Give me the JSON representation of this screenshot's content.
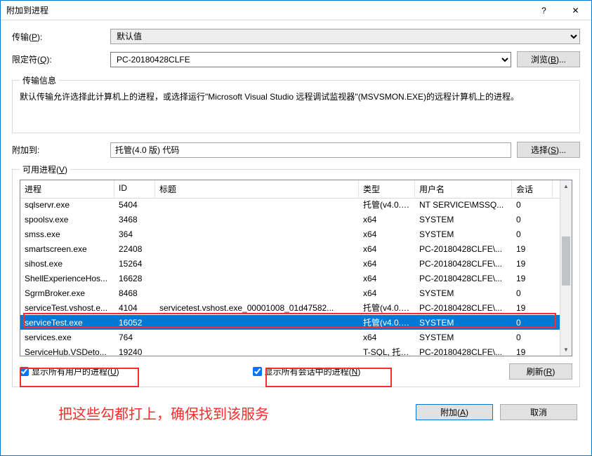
{
  "titlebar": {
    "title": "附加到进程",
    "help": "?",
    "close": "✕"
  },
  "labels": {
    "transport": "传输(<u>P</u>):",
    "qualifier": "限定符(<u>Q</u>):",
    "browse": "浏览(<u>B</u>)...",
    "transport_info_title": "传输信息",
    "transport_info_text": "默认传输允许选择此计算机上的进程，或选择运行\"Microsoft Visual Studio 远程调试监视器\"(MSVSMON.EXE)的远程计算机上的进程。",
    "attach_to": "附加到:",
    "select": "选择(<u>S</u>)...",
    "available_procs": "可用进程(<u>V</u>)",
    "show_all_users": "显示所有用户的进程(<u>U</u>)",
    "show_all_sessions": "显示所有会话中的进程(<u>N</u>)",
    "refresh": "刷新(<u>R</u>)",
    "attach": "附加(<u>A</u>)",
    "cancel": "取消"
  },
  "transport_value": "默认值",
  "qualifier_value": "PC-20180428CLFE",
  "attach_to_value": "托管(4.0 版) 代码",
  "columns": {
    "process": "进程",
    "id": "ID",
    "title": "标题",
    "type": "类型",
    "user": "用户名",
    "session": "会话"
  },
  "rows": [
    {
      "p": "sqlservr.exe",
      "id": "5404",
      "t": "",
      "ty": "托管(v4.0.30...",
      "u": "NT SERVICE\\MSSQ...",
      "s": "0",
      "sel": false
    },
    {
      "p": "spoolsv.exe",
      "id": "3468",
      "t": "",
      "ty": "x64",
      "u": "SYSTEM",
      "s": "0",
      "sel": false
    },
    {
      "p": "smss.exe",
      "id": "364",
      "t": "",
      "ty": "x64",
      "u": "SYSTEM",
      "s": "0",
      "sel": false
    },
    {
      "p": "smartscreen.exe",
      "id": "22408",
      "t": "",
      "ty": "x64",
      "u": "PC-20180428CLFE\\...",
      "s": "19",
      "sel": false
    },
    {
      "p": "sihost.exe",
      "id": "15264",
      "t": "",
      "ty": "x64",
      "u": "PC-20180428CLFE\\...",
      "s": "19",
      "sel": false
    },
    {
      "p": "ShellExperienceHos...",
      "id": "16628",
      "t": "",
      "ty": "x64",
      "u": "PC-20180428CLFE\\...",
      "s": "19",
      "sel": false
    },
    {
      "p": "SgrmBroker.exe",
      "id": "8468",
      "t": "",
      "ty": "x64",
      "u": "SYSTEM",
      "s": "0",
      "sel": false
    },
    {
      "p": "serviceTest.vshost.e...",
      "id": "4104",
      "t": "servicetest.vshost.exe_00001008_01d47582...",
      "ty": "托管(v4.0.30...",
      "u": "PC-20180428CLFE\\...",
      "s": "19",
      "sel": false
    },
    {
      "p": "serviceTest.exe",
      "id": "16052",
      "t": "",
      "ty": "托管(v4.0.30...",
      "u": "SYSTEM",
      "s": "0",
      "sel": true
    },
    {
      "p": "services.exe",
      "id": "764",
      "t": "",
      "ty": "x64",
      "u": "SYSTEM",
      "s": "0",
      "sel": false
    },
    {
      "p": "ServiceHub.VSDeto...",
      "id": "19240",
      "t": "",
      "ty": "T-SQL, 托管(...",
      "u": "PC-20180428CLFE\\...",
      "s": "19",
      "sel": false
    }
  ],
  "checks": {
    "all_users": true,
    "all_sessions": true
  },
  "annotation": "把这些勾都打上，确保找到该服务"
}
